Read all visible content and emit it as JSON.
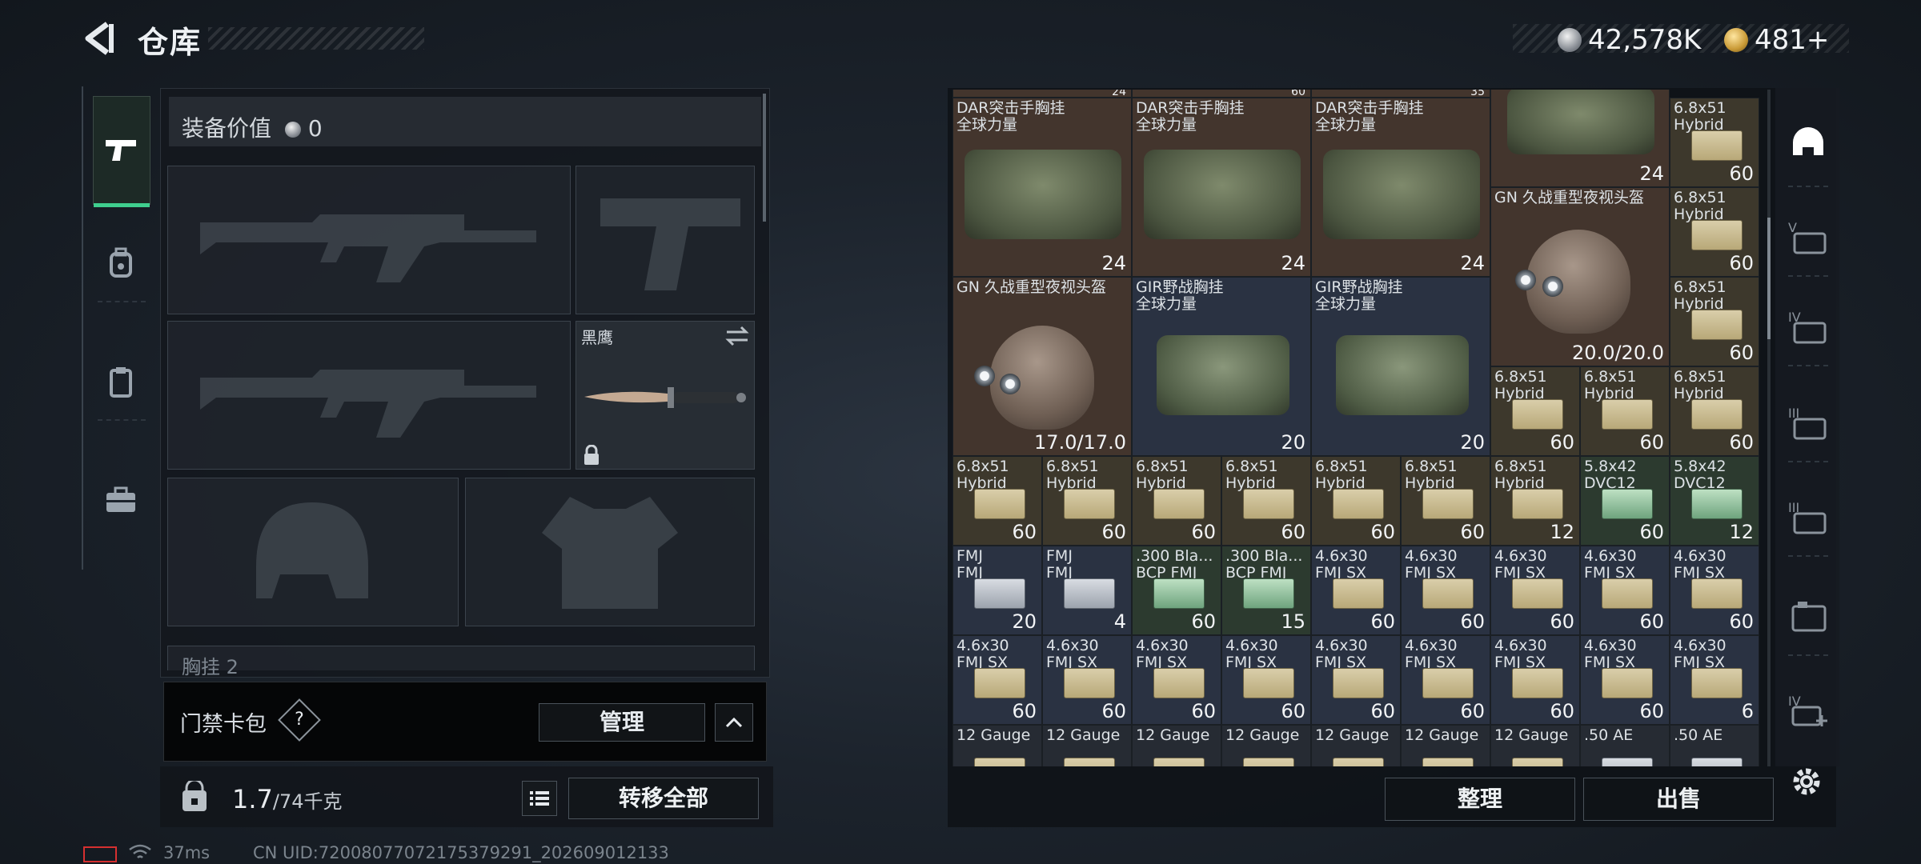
{
  "header": {
    "title": "仓库",
    "currency": {
      "silver": "42,578K",
      "gold": "481+"
    }
  },
  "left_nav": [
    {
      "name": "weapons",
      "icon": "pistol-icon",
      "active": true
    },
    {
      "name": "gear",
      "icon": "backpack-icon",
      "active": false
    },
    {
      "name": "consumables",
      "icon": "clipboard-icon",
      "active": false
    },
    {
      "name": "medkit",
      "icon": "toolbox-icon",
      "active": false
    }
  ],
  "loadout": {
    "equip_value_label": "装备价值",
    "equip_value": "0",
    "knife_name": "黑鹰",
    "chest_label": "胸挂",
    "chest_count": "2",
    "keycard_label": "门禁卡包",
    "keycard_help": "?",
    "manage_label": "管理",
    "weight_current": "1.7",
    "weight_max": "/74千克",
    "transfer_all_label": "转移全部"
  },
  "status_bar": {
    "ping": "37ms",
    "uid": "CN UID:720080770721753792​91_202609012133"
  },
  "storage": {
    "top_partial": [
      "24",
      "60",
      "35"
    ],
    "rows": [
      [
        {
          "name": "DAR突击手胸挂",
          "sub": "全球力量",
          "count": "24",
          "type": "bag"
        },
        {
          "name": "DAR突击手胸挂",
          "sub": "全球力量",
          "count": "24",
          "type": "bag"
        },
        {
          "name": "DAR突击手胸挂",
          "sub": "全球力量",
          "count": "24",
          "type": "bag"
        },
        {
          "name": "",
          "sub": "",
          "count": "24",
          "type": "bag"
        },
        {
          "name": "6.8x51",
          "sub": "Hybrid",
          "count": "60",
          "type": "ammo"
        }
      ]
    ],
    "helmet_a": {
      "name": "GN 久战重型夜视头盔",
      "durability": "20.0/20.0"
    },
    "helmet_b": {
      "name": "GN 久战重型夜视头盔",
      "durability": "17.0/17.0"
    },
    "gir_bag": {
      "name": "GIR野战胸挂",
      "sub": "全球力量",
      "count": "20"
    },
    "col5_ammo": [
      {
        "name": "6.8x51",
        "sub": "Hybrid",
        "count": "60"
      },
      {
        "name": "6.8x51",
        "sub": "Hybrid",
        "count": "60"
      },
      {
        "name": "6.8x51",
        "sub": "Hybrid",
        "count": "60"
      }
    ],
    "row_hybrid_small": [
      {
        "name": "6.8x51",
        "sub": "Hybrid",
        "count": "60"
      },
      {
        "name": "6.8x51",
        "sub": "Hybrid",
        "count": "60"
      }
    ],
    "row5": [
      {
        "name": "6.8x51",
        "sub": "Hybrid",
        "count": "60",
        "box": "ammo",
        "bg": "olive"
      },
      {
        "name": "6.8x51",
        "sub": "Hybrid",
        "count": "60",
        "box": "ammo",
        "bg": "olive"
      },
      {
        "name": "6.8x51",
        "sub": "Hybrid",
        "count": "60",
        "box": "ammo",
        "bg": "olive"
      },
      {
        "name": "6.8x51",
        "sub": "Hybrid",
        "count": "60",
        "box": "ammo",
        "bg": "olive"
      },
      {
        "name": "6.8x51",
        "sub": "Hybrid",
        "count": "60",
        "box": "ammo",
        "bg": "olive"
      },
      {
        "name": "6.8x51",
        "sub": "Hybrid",
        "count": "60",
        "box": "ammo",
        "bg": "olive"
      },
      {
        "name": "6.8x51",
        "sub": "Hybrid",
        "count": "12",
        "box": "ammo",
        "bg": "olive"
      },
      {
        "name": "5.8x42",
        "sub": "DVC12",
        "count": "60",
        "box": "green",
        "bg": "green"
      },
      {
        "name": "5.8x42",
        "sub": "DVC12",
        "count": "12",
        "box": "green",
        "bg": "green"
      }
    ],
    "row6": [
      {
        "name": "FMJ",
        "sub": "FMJ",
        "count": "20",
        "box": "gray",
        "bg": "blue"
      },
      {
        "name": "FMJ",
        "sub": "FMJ",
        "count": "4",
        "box": "gray",
        "bg": "blue"
      },
      {
        "name": ".300 Bla...",
        "sub": "BCP FMJ",
        "count": "60",
        "box": "green",
        "bg": "green"
      },
      {
        "name": ".300 Bla...",
        "sub": "BCP FMJ",
        "count": "15",
        "box": "green",
        "bg": "green"
      },
      {
        "name": "4.6x30",
        "sub": "FMJ SX",
        "count": "60",
        "box": "ammo",
        "bg": "blue"
      },
      {
        "name": "4.6x30",
        "sub": "FMJ SX",
        "count": "60",
        "box": "ammo",
        "bg": "blue"
      },
      {
        "name": "4.6x30",
        "sub": "FMJ SX",
        "count": "60",
        "box": "ammo",
        "bg": "blue"
      },
      {
        "name": "4.6x30",
        "sub": "FMJ SX",
        "count": "60",
        "box": "ammo",
        "bg": "blue"
      },
      {
        "name": "4.6x30",
        "sub": "FMJ SX",
        "count": "60",
        "box": "ammo",
        "bg": "blue"
      }
    ],
    "row7": [
      {
        "name": "4.6x30",
        "sub": "FMJ SX",
        "count": "60",
        "box": "ammo",
        "bg": "blue"
      },
      {
        "name": "4.6x30",
        "sub": "FMJ SX",
        "count": "60",
        "box": "ammo",
        "bg": "blue"
      },
      {
        "name": "4.6x30",
        "sub": "FMJ SX",
        "count": "60",
        "box": "ammo",
        "bg": "blue"
      },
      {
        "name": "4.6x30",
        "sub": "FMJ SX",
        "count": "60",
        "box": "ammo",
        "bg": "blue"
      },
      {
        "name": "4.6x30",
        "sub": "FMJ SX",
        "count": "60",
        "box": "ammo",
        "bg": "blue"
      },
      {
        "name": "4.6x30",
        "sub": "FMJ SX",
        "count": "60",
        "box": "ammo",
        "bg": "blue"
      },
      {
        "name": "4.6x30",
        "sub": "FMJ SX",
        "count": "60",
        "box": "ammo",
        "bg": "blue"
      },
      {
        "name": "4.6x30",
        "sub": "FMJ SX",
        "count": "60",
        "box": "ammo",
        "bg": "blue"
      },
      {
        "name": "4.6x30",
        "sub": "FMJ SX",
        "count": "6",
        "box": "ammo",
        "bg": "blue"
      }
    ],
    "row8": [
      {
        "name": "12 Gauge",
        "sub": "",
        "count": "",
        "box": "ammo",
        "bg": "dark"
      },
      {
        "name": "12 Gauge",
        "sub": "",
        "count": "",
        "box": "ammo",
        "bg": "dark"
      },
      {
        "name": "12 Gauge",
        "sub": "",
        "count": "",
        "box": "ammo",
        "bg": "dark"
      },
      {
        "name": "12 Gauge",
        "sub": "",
        "count": "",
        "box": "ammo",
        "bg": "dark"
      },
      {
        "name": "12 Gauge",
        "sub": "",
        "count": "",
        "box": "ammo",
        "bg": "dark"
      },
      {
        "name": "12 Gauge",
        "sub": "",
        "count": "",
        "box": "ammo",
        "bg": "dark"
      },
      {
        "name": "12 Gauge",
        "sub": "",
        "count": "",
        "box": "ammo",
        "bg": "dark"
      },
      {
        "name": ".50 AE",
        "sub": "",
        "count": "",
        "box": "gray",
        "bg": "dark"
      },
      {
        "name": ".50 AE",
        "sub": "",
        "count": "",
        "box": "gray",
        "bg": "dark"
      }
    ]
  },
  "right_nav": [
    {
      "label": "",
      "icon": "helmet-icon"
    },
    {
      "label": "V",
      "icon": "armor-tier-v-icon"
    },
    {
      "label": "IV",
      "icon": "armor-tier-iv-icon"
    },
    {
      "label": "III",
      "icon": "armor-tier-iii-icon"
    },
    {
      "label": "III",
      "icon": "armor-tier-iii-alt-icon"
    },
    {
      "label": "",
      "icon": "rig-icon"
    },
    {
      "label": "IV",
      "icon": "add-tier-iv-icon"
    }
  ],
  "actions": {
    "sort_label": "整理",
    "sell_label": "出售"
  },
  "colors": {
    "accent": "#3fcf8e",
    "panel": "#14181d",
    "brown_cell": "#43352d",
    "blue_cell": "#2a3242"
  }
}
